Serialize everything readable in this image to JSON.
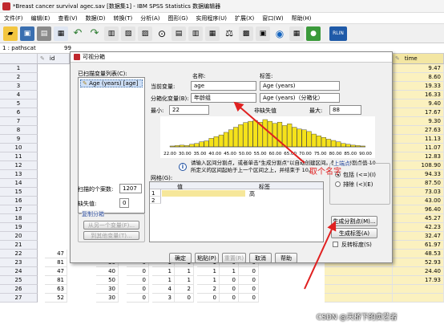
{
  "window": {
    "title": "*Breast cancer survival agec.sav [数据集1] - IBM SPSS Statistics 数据编辑器"
  },
  "menu": [
    "文件(F)",
    "编辑(E)",
    "查看(V)",
    "数据(D)",
    "转换(T)",
    "分析(A)",
    "图形(G)",
    "实用程序(U)",
    "扩展(X)",
    "窗口(W)",
    "帮助(H)"
  ],
  "toolbar": {
    "rlin_label": "RLIN"
  },
  "cellref": {
    "name": "1 : pathscat",
    "value": "99"
  },
  "grid": {
    "col_id": "id",
    "col_time": "time",
    "row_numbers": [
      "1",
      "2",
      "3",
      "4",
      "5",
      "6",
      "7",
      "8",
      "9",
      "10",
      "11",
      "12",
      "13",
      "14",
      "15",
      "16",
      "17",
      "18",
      "19",
      "20",
      "21",
      "22",
      "23",
      "24",
      "25",
      "26",
      "27"
    ],
    "time_values": [
      "9.47",
      "8.60",
      "19.33",
      "16.33",
      "9.40",
      "17.67",
      "9.30",
      "27.63",
      "11.13",
      "11.07",
      "12.83",
      "108.90",
      "94.33",
      "87.50",
      "73.03",
      "43.00",
      "96.40",
      "45.27",
      "42.23",
      "32.47",
      "61.97",
      "48.53",
      "52.93",
      "24.40",
      "17.93",
      "",
      ""
    ],
    "lower_rows": [
      [
        "47",
        "30",
        "0",
        "2",
        "2",
        "2",
        "1",
        "0"
      ],
      [
        "81",
        "30",
        "0",
        "1",
        "1",
        "1",
        "0",
        "0"
      ],
      [
        "47",
        "40",
        "0",
        "1",
        "1",
        "1",
        "1",
        "0"
      ],
      [
        "81",
        "50",
        "0",
        "1",
        "1",
        "1",
        "0",
        "0"
      ],
      [
        "63",
        "30",
        "0",
        "4",
        "2",
        "2",
        "0",
        "0"
      ],
      [
        "52",
        "30",
        "0",
        "3",
        "0",
        "0",
        "0",
        "0"
      ]
    ]
  },
  "dialog": {
    "title": "可视分箱",
    "scanned_vars_label": "已扫描变量列表(C):",
    "scanned_var_item": "Age (years) [age]",
    "name_header": "名称:",
    "label_header": "标签:",
    "current_var_label": "当前变量:",
    "current_var_name": "age",
    "current_var_desc": "Age (years)",
    "binned_var_label": "分箱化变量(B):",
    "binned_var_name": "年龄组",
    "binned_var_desc": "Age (years)（分箱化）",
    "min_label": "最小:",
    "min_value": "22",
    "nonmissing_label": "非缺失值",
    "max_label": "最大:",
    "max_value": "88",
    "histogram_ticks": [
      "22.00",
      "30.00",
      "35.00",
      "40.00",
      "45.00",
      "50.00",
      "55.00",
      "60.00",
      "65.00",
      "70.00",
      "75.00",
      "80.00",
      "85.00",
      "90.00"
    ],
    "histogram_counts": [
      2,
      3,
      4,
      3,
      6,
      8,
      12,
      14,
      20,
      24,
      28,
      34,
      40,
      46,
      52,
      57,
      60,
      62,
      58,
      64,
      60,
      55,
      58,
      50,
      54,
      46,
      42,
      40,
      36,
      30,
      26,
      22,
      18,
      15,
      12,
      8,
      6,
      4,
      3,
      2
    ],
    "info_text": "请输入区间分割点，或者单击\"生成分割点\"以自动创建区间。例如：分割点值 10 所定义的区间起始于上一个区间之上，并结束于 10。",
    "grid_label": "网格(G):",
    "grid_col_value": "值",
    "grid_col_label": "标签",
    "grid_row1_num": "1",
    "grid_row1_value": "",
    "grid_row1_label": "高",
    "grid_row2_num": "2",
    "upper_endpoint_label": "上端点",
    "include_label": "包括 (<=)(I)",
    "exclude_label": "排除 (<)(E)",
    "make_cutpoints_btn": "生成分割点(M)...",
    "make_labels_btn": "生成标签(A)",
    "reverse_label": "反转标度(S)",
    "scanned_cases_label": "扫描的个案数:",
    "scanned_cases_value": "1207",
    "missing_label": "缺失值:",
    "missing_value": "0",
    "copy_bins_label": "复制分箱",
    "from_other_btn": "从另一个变量(F)...",
    "to_other_btn": "到其他变量(T)...",
    "ok_btn": "确定",
    "paste_btn": "粘贴(P)",
    "reset_btn": "重置(R)",
    "cancel_btn": "取消",
    "help_btn": "帮助"
  },
  "annotation": {
    "text": "取个名字",
    "color": "#e02020"
  },
  "watermark": "CSDN @天桥下的卖艺者"
}
